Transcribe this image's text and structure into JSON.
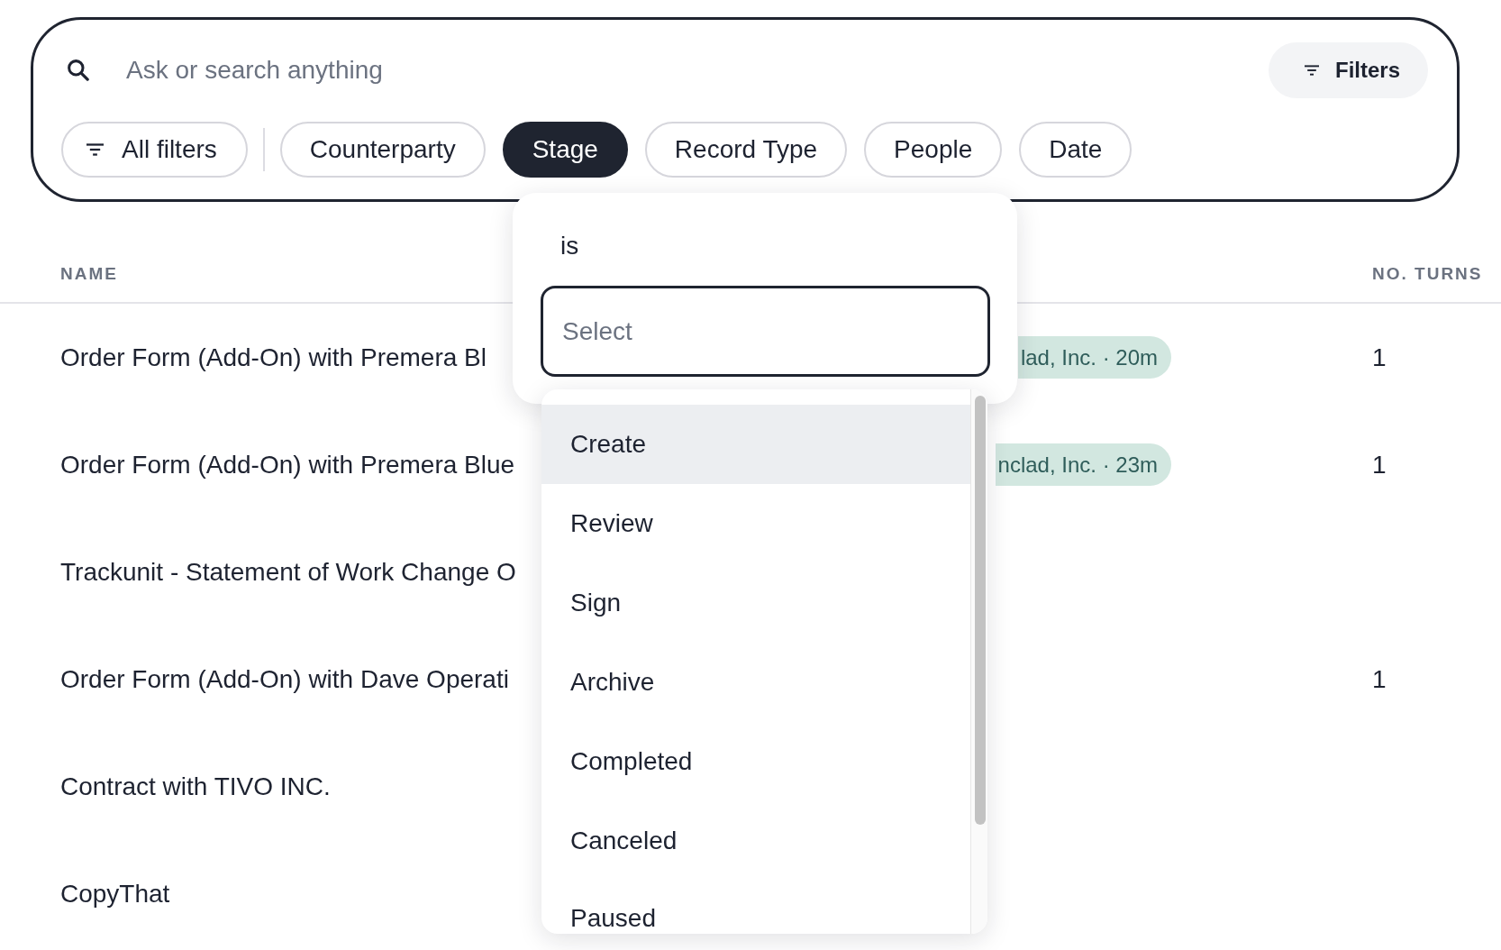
{
  "search": {
    "placeholder": "Ask or search anything",
    "filters_button": {
      "label": "Filters"
    }
  },
  "all_filters_button": {
    "label": "All filters"
  },
  "filter_chips": [
    {
      "label": "Counterparty",
      "selected": false
    },
    {
      "label": "Stage",
      "selected": true
    },
    {
      "label": "Record Type",
      "selected": false
    },
    {
      "label": "People",
      "selected": false
    },
    {
      "label": "Date",
      "selected": false
    }
  ],
  "table": {
    "columns": [
      "NAME",
      "NO. TURNS"
    ],
    "rows": [
      {
        "name": "Order Form (Add-On) with Premera Bl",
        "column_2": "lad, Inc. · 20m",
        "turns": "1"
      },
      {
        "name": "Order Form (Add-On) with Premera Blue",
        "column_2": "nclad, Inc. · 23m",
        "turns": "1"
      },
      {
        "name": "Trackunit - Statement of Work Change O"
      },
      {
        "name": "Order Form (Add-On) with Dave Operati",
        "turns": "1"
      },
      {
        "name": "Contract with TIVO INC."
      },
      {
        "name": "CopyThat"
      }
    ]
  },
  "stage_popover": {
    "operator": "is",
    "select": {
      "placeholder": "Select"
    },
    "options": [
      {
        "label": "Create",
        "highlighted": true
      },
      {
        "label": "Review",
        "highlighted": false
      },
      {
        "label": "Sign",
        "highlighted": false
      },
      {
        "label": "Archive",
        "highlighted": false
      },
      {
        "label": "Completed",
        "highlighted": false
      },
      {
        "label": "Canceled",
        "highlighted": false
      },
      {
        "label": "Paused",
        "highlighted": false
      }
    ]
  }
}
